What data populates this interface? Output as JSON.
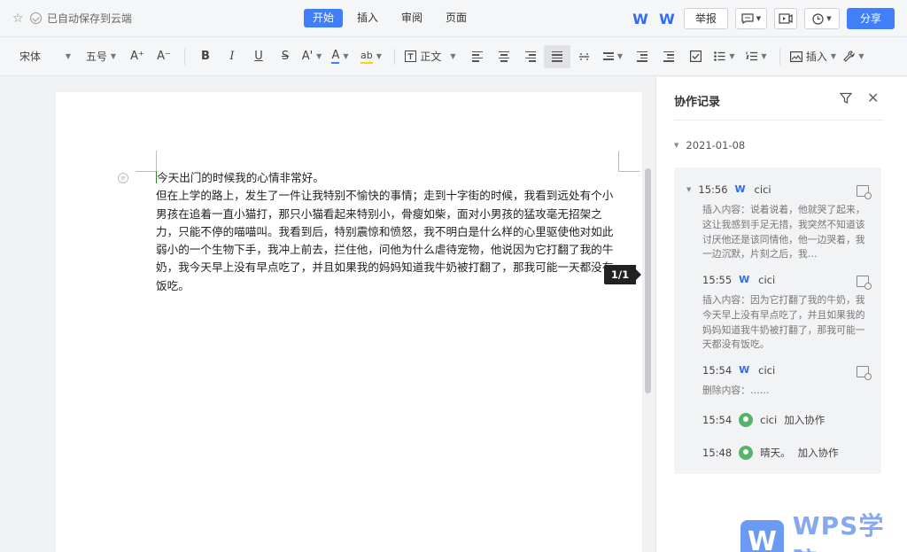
{
  "topbar": {
    "autosave_text": "已自动保存到云端",
    "tabs": [
      {
        "label": "开始",
        "active": true
      },
      {
        "label": "插入",
        "active": false
      },
      {
        "label": "审阅",
        "active": false
      },
      {
        "label": "页面",
        "active": false
      }
    ],
    "report_label": "举报",
    "share_label": "分享",
    "accent": "#417ff9"
  },
  "toolbar": {
    "font_name": "宋体",
    "font_size": "五号",
    "grow_font": "A⁺",
    "shrink_font": "A⁻",
    "bold": "B",
    "italic": "I",
    "underline": "U",
    "strike": "S",
    "superscript": "A'",
    "font_color": "A",
    "highlight": "ab",
    "style_label": "正文",
    "insert_label": "插入"
  },
  "document": {
    "page_indicator": "1/1",
    "paragraphs": [
      "今天出门的时候我的心情非常好。",
      "但在上学的路上，发生了一件让我特别不愉快的事情；走到十字街的时候，我看到远处有个小男孩在追着一直小猫打，那只小猫看起来特别小，骨瘦如柴，面对小男孩的猛攻毫无招架之力，只能不停的喵喵叫。我看到后，特别震惊和愤怒，我不明白是什么样的心里驱使他对如此弱小的一个生物下手，我冲上前去，拦住他，问他为什么虐待宠物，他说因为它打翻了我的牛奶，我今天早上没有早点吃了，并且如果我的妈妈知道我牛奶被打翻了，那我可能一天都没有饭吃。"
    ]
  },
  "panel": {
    "title": "协作记录",
    "date": "2021-01-08",
    "entries": [
      {
        "time": "15:56",
        "user": "cici",
        "text": "插入内容：说着说着，他就哭了起来，这让我感到手足无措，我突然不知道该讨厌他还是该同情他，他一边哭着，我一边沉默，片刻之后，我…"
      },
      {
        "time": "15:55",
        "user": "cici",
        "text": "插入内容：因为它打翻了我的牛奶，我今天早上没有早点吃了，并且如果我的妈妈知道我牛奶被打翻了，那我可能一天都没有饭吃。"
      },
      {
        "time": "15:54",
        "user": "cici",
        "text": "删除内容：……"
      },
      {
        "time": "15:54",
        "user": "cici",
        "action": "加入协作"
      },
      {
        "time": "15:48",
        "user": "晴天。",
        "action": "加入协作"
      }
    ]
  },
  "watermark": {
    "logo_letter": "W",
    "text": "WPS学院"
  }
}
